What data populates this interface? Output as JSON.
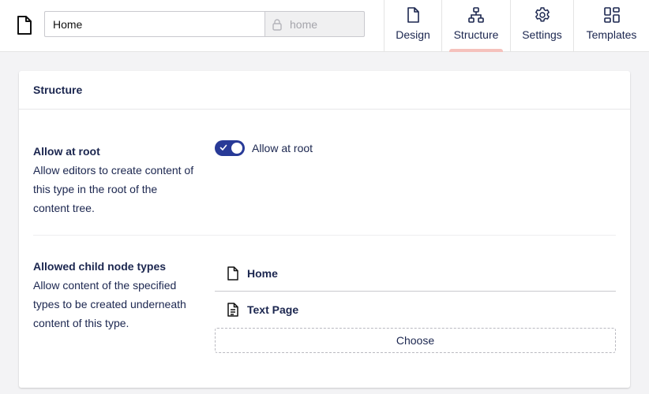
{
  "header": {
    "name_value": "Home",
    "alias_value": "home",
    "icons": {
      "document": "document-icon",
      "lock": "lock-icon"
    }
  },
  "tabs": [
    {
      "label": "Design",
      "icon": "design-document-icon",
      "active": false
    },
    {
      "label": "Structure",
      "icon": "sitemap-icon",
      "active": true
    },
    {
      "label": "Settings",
      "icon": "gear-icon",
      "active": false
    },
    {
      "label": "Templates",
      "icon": "layout-grid-icon",
      "active": false
    }
  ],
  "card": {
    "title": "Structure",
    "allow_at_root": {
      "label": "Allow at root",
      "description": "Allow editors to create content of this type in the root of the content tree.",
      "toggle_label": "Allow at root",
      "enabled": true
    },
    "allowed_children": {
      "label": "Allowed child node types",
      "description": "Allow content of the specified types to be created underneath content of this type.",
      "items": [
        {
          "label": "Home",
          "icon": "document-icon"
        },
        {
          "label": "Text Page",
          "icon": "document-text-icon"
        }
      ],
      "choose_label": "Choose"
    }
  },
  "colors": {
    "accent": "#283a97",
    "active_tab_bar": "#f5c1bc",
    "text": "#1b264f",
    "background": "#f3f3f5"
  }
}
